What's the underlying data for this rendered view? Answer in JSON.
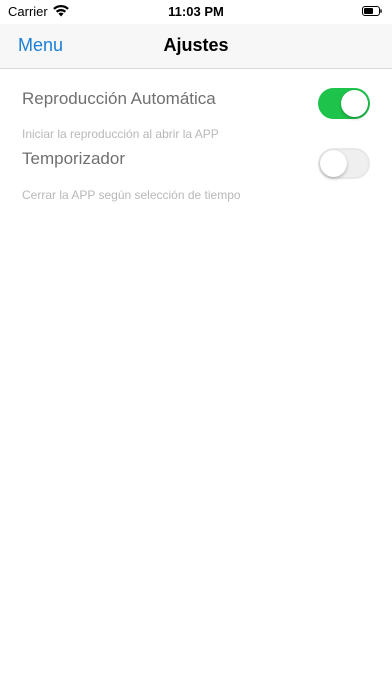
{
  "status_bar": {
    "carrier": "Carrier",
    "time": "11:03 PM",
    "wifi_icon": "wifi-icon",
    "battery_icon": "battery-icon"
  },
  "nav": {
    "back_label": "Menu",
    "title": "Ajustes"
  },
  "settings": [
    {
      "label": "Reproducción Automática",
      "description": "Iniciar la reproducción al abrir la APP",
      "enabled": true
    },
    {
      "label": "Temporizador",
      "description": "Cerrar la APP según selección de tiempo",
      "enabled": false
    }
  ],
  "colors": {
    "accent": "#1a7fd6",
    "toggle_on": "#1dc34a",
    "toggle_off": "#efefef"
  }
}
